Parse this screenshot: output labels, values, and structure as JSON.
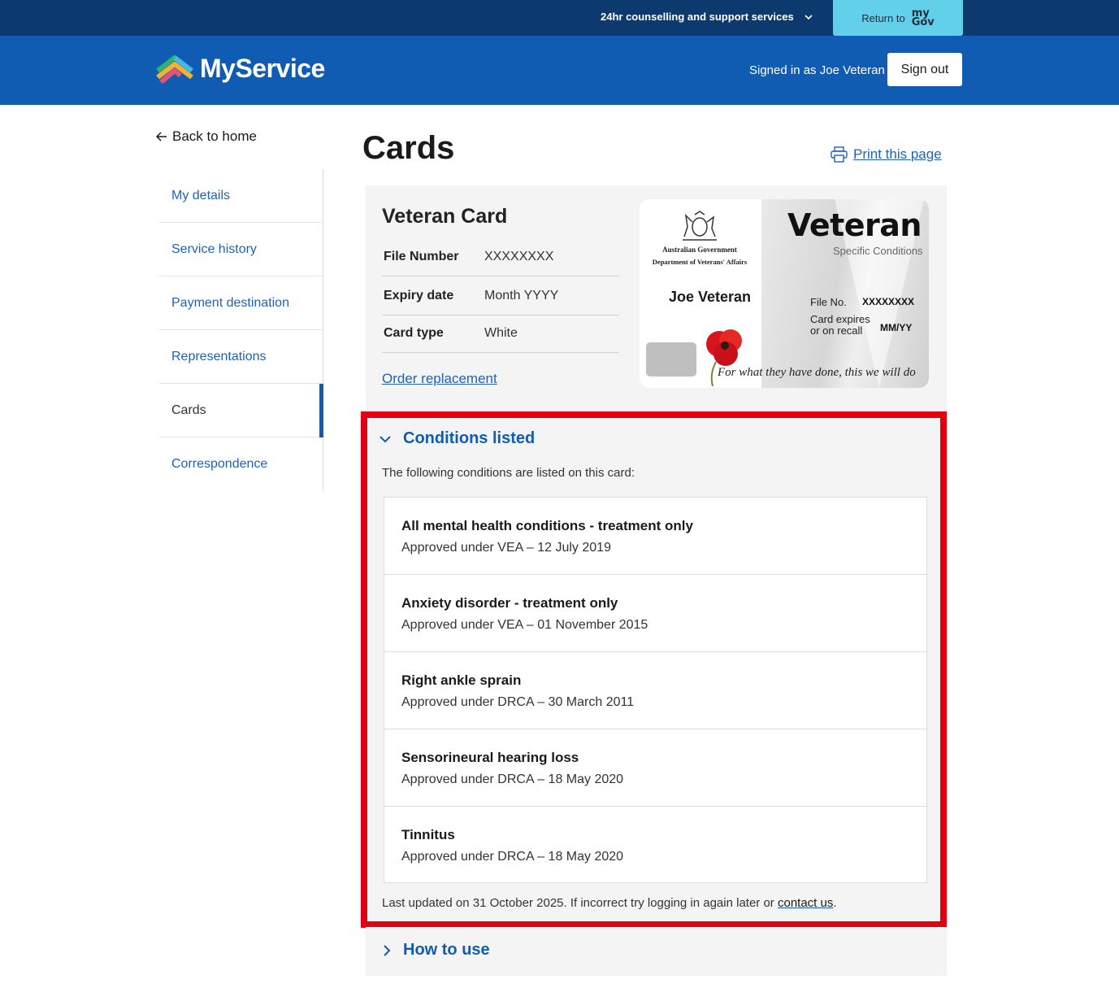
{
  "topbar": {
    "support_label": "24hr counselling and support services",
    "return_label": "Return to",
    "mygov_logo_top": "my",
    "mygov_logo_bottom": "Gov"
  },
  "header": {
    "brand": "MyService",
    "signed_in": "Signed in as Joe Veteran",
    "sign_out": "Sign out"
  },
  "sidebar": {
    "back": "Back to home",
    "items": [
      {
        "label": "My details",
        "active": false
      },
      {
        "label": "Service history",
        "active": false
      },
      {
        "label": "Payment destination",
        "active": false
      },
      {
        "label": "Representations",
        "active": false
      },
      {
        "label": "Cards",
        "active": true
      },
      {
        "label": "Correspondence",
        "active": false
      }
    ]
  },
  "main": {
    "title": "Cards",
    "print": "Print this page",
    "card": {
      "title": "Veteran Card",
      "rows": [
        {
          "key": "File Number",
          "value": "XXXXXXXX"
        },
        {
          "key": "Expiry date",
          "value": "Month YYYY"
        },
        {
          "key": "Card type",
          "value": "White"
        }
      ],
      "order": "Order replacement",
      "image": {
        "gov_line1": "Australian Government",
        "gov_line2": "Department of Veterans' Affairs",
        "holder": "Joe Veteran",
        "heading": "Veteran",
        "subheading": "Specific Conditions",
        "file_label": "File No.",
        "file_value": "XXXXXXXX",
        "expires_label": "Card expires or on recall",
        "expires_value": "MM/YY",
        "motto": "For what they have done, this we will do"
      }
    },
    "conditions": {
      "heading": "Conditions listed",
      "intro": "The following conditions are listed on this card:",
      "items": [
        {
          "title": "All mental health conditions - treatment only",
          "detail": "Approved under VEA – 12 July 2019"
        },
        {
          "title": "Anxiety disorder - treatment only",
          "detail": "Approved under VEA – 01 November 2015"
        },
        {
          "title": "Right ankle sprain",
          "detail": "Approved under DRCA – 30 March 2011"
        },
        {
          "title": "Sensorineural hearing loss",
          "detail": "Approved under DRCA – 18 May 2020"
        },
        {
          "title": "Tinnitus",
          "detail": "Approved under DRCA – 18 May 2020"
        }
      ],
      "updated_prefix": "Last updated on 31 October 2025. If incorrect try logging in again later or",
      "updated_link": "contact us",
      "updated_suffix": "."
    },
    "howto": {
      "heading": "How to use"
    }
  },
  "colors": {
    "topbar": "#0c3a6e",
    "header": "#0f5cb2",
    "mygov": "#63d0e9",
    "link": "#1f62b8",
    "highlight": "#e3000f"
  }
}
